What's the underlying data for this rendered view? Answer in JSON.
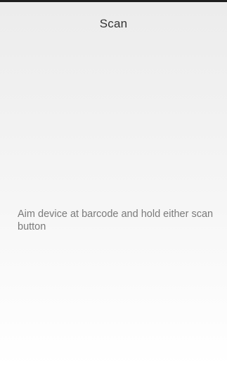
{
  "app_bar": {
    "title": "Scan"
  },
  "main": {
    "instruction": "Aim device at barcode and hold either scan button"
  },
  "colors": {
    "title_text": "#333333",
    "body_text": "#7a7a7a",
    "top_border": "#1f1f1f",
    "background_top": "#ececec",
    "background_bottom": "#ffffff"
  }
}
